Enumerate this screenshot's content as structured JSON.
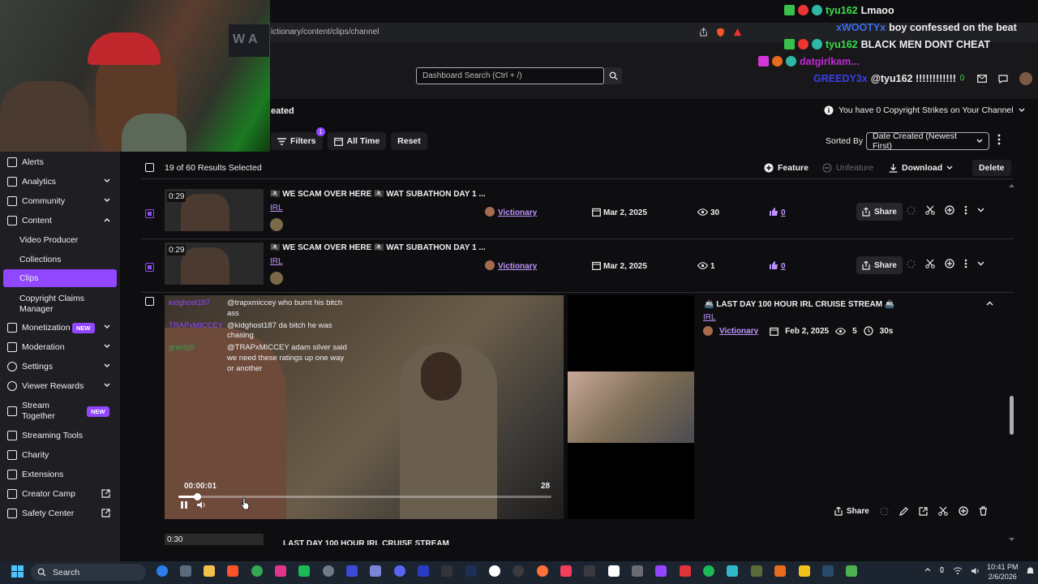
{
  "browser": {
    "url": "ictionary/content/clips/channel"
  },
  "header": {
    "search_placeholder": "Dashboard Search (Ctrl + /)",
    "page_title": "eated",
    "copyright_notice": "You have 0 Copyright Strikes on Your Channel"
  },
  "toolbar": {
    "filters_label": "Filters",
    "filters_count": "1",
    "all_time_label": "All Time",
    "reset_label": "Reset",
    "sorted_by_label": "Sorted By",
    "sort_value": "Date Created (Newest First)"
  },
  "results": {
    "selected_text": "19 of 60 Results Selected",
    "feature_label": "Feature",
    "unfeature_label": "Unfeature",
    "download_label": "Download",
    "delete_label": "Delete"
  },
  "sidebar": {
    "items": [
      {
        "label": "Alerts"
      },
      {
        "label": "Analytics"
      },
      {
        "label": "Community"
      },
      {
        "label": "Content"
      },
      {
        "label": "Video Producer"
      },
      {
        "label": "Collections"
      },
      {
        "label": "Clips"
      },
      {
        "label": "Copyright Claims Manager"
      },
      {
        "label": "Monetization"
      },
      {
        "label": "Moderation"
      },
      {
        "label": "Settings"
      },
      {
        "label": "Viewer Rewards"
      },
      {
        "label": "Stream Together"
      },
      {
        "label": "Streaming Tools"
      },
      {
        "label": "Charity"
      },
      {
        "label": "Extensions"
      },
      {
        "label": "Creator Camp"
      },
      {
        "label": "Safety Center"
      }
    ],
    "new_badge": "NEW"
  },
  "clips": [
    {
      "duration": "0:29",
      "title": "🏴‍☠️ WE SCAM OVER HERE 🏴‍☠️ WAT SUBATHON DAY 1 ...",
      "category": "IRL",
      "channel": "Victionary",
      "date": "Mar 2, 2025",
      "views": "30",
      "likes": "0",
      "share_label": "Share"
    },
    {
      "duration": "0:29",
      "title": "🏴‍☠️ WE SCAM OVER HERE 🏴‍☠️ WAT SUBATHON DAY 1 ...",
      "category": "IRL",
      "channel": "Victionary",
      "date": "Mar 2, 2025",
      "views": "1",
      "likes": "0",
      "share_label": "Share"
    }
  ],
  "expanded_clip": {
    "title": "🚢 LAST DAY 100 HOUR IRL CRUISE STREAM 🚢",
    "category": "IRL",
    "channel": "Victionary",
    "date": "Feb 2, 2025",
    "views": "5",
    "duration": "30s",
    "current_time": "00:00:01",
    "end_time": "28",
    "progress": 0.05,
    "share_label": "Share",
    "chat": [
      {
        "user": "kidghost187",
        "text": "@trapxmiccey who burnt his bitch ass"
      },
      {
        "user": "TRAPxMICCEY",
        "text": "@kidghost187 da bitch he was chasing"
      },
      {
        "user": "grantg5",
        "text": "@TRAPxMICCEY adam silver said we need these ratings up one way or another"
      }
    ]
  },
  "next_clip": {
    "duration": "0:30",
    "title": "LAST DAY 100 HOUR IRL CRUISE STREAM"
  },
  "stream_chat": [
    {
      "user": "tyu162",
      "text": "Lmaoo"
    },
    {
      "user": "xWOOTYx",
      "text": "boy confessed on the beat"
    },
    {
      "user": "tyu162",
      "text": "BLACK MEN DONT CHEAT"
    },
    {
      "user": "datgirlkam...",
      "text": ""
    },
    {
      "user": "GREEDY3x",
      "text": "@tyu162 !!!!!!!!!!!!"
    }
  ],
  "webcam_sign": "W A",
  "taskbar": {
    "search_label": "Search",
    "time": "10:41 PM",
    "date": "2/6/2026"
  },
  "colors": {
    "accent": "#9147ff",
    "link": "#bf94ff",
    "background": "#0e0e10",
    "sidebar": "#1f1f23"
  }
}
